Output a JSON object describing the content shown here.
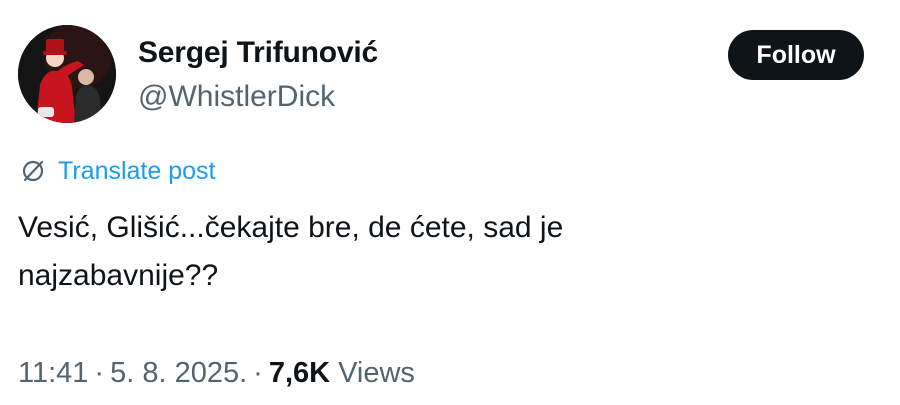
{
  "author": {
    "name": "Sergej Trifunović",
    "handle": "@WhistlerDick"
  },
  "follow_label": "Follow",
  "translate": {
    "label": "Translate post",
    "icon": "globe-slash-icon"
  },
  "post": {
    "lines": [
      "Vesić, Glišić...čekajte bre, de ćete, sad je",
      "najzabavnije??"
    ]
  },
  "meta": {
    "time": "11:41",
    "separator": "·",
    "date": "5. 8. 2025.",
    "views_count": "7,6K",
    "views_label": "Views"
  },
  "colors": {
    "text": "#0f1419",
    "muted": "#536471",
    "link": "#1d9bf0",
    "button_bg": "#0f1419",
    "button_text": "#ffffff"
  }
}
